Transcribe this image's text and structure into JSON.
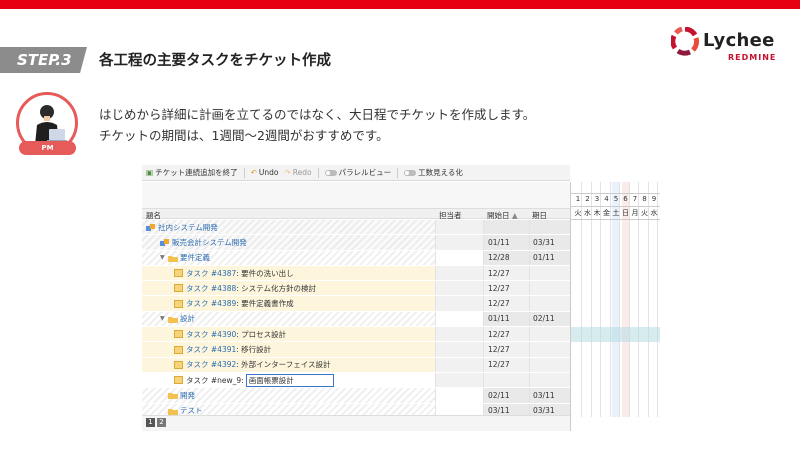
{
  "slide": {
    "step_label": "STEP.3",
    "step_title": "各工程の主要タスクをチケット作成",
    "description_line1": "はじめから詳細に計画を立てるのではなく、大日程でチケットを作成します。",
    "description_line2": "チケットの期間は、1週間〜2週間がおすすめです。",
    "avatar_badge": "PM",
    "logo_name": "Lychee",
    "logo_sub": "REDMINE",
    "accent_color": "#e60012"
  },
  "toolbar": {
    "end_continuous_add": "チケット連続追加を終了",
    "undo": "Undo",
    "redo": "Redo",
    "parallel_view": "パラレルビュー",
    "effort_visible": "工数見える化"
  },
  "columns": {
    "title": "題名",
    "assignee": "担当者",
    "start": "開始日",
    "due": "期日"
  },
  "rows": [
    {
      "kind": "project",
      "indent": 0,
      "label": "社内システム開発",
      "start": "",
      "due": ""
    },
    {
      "kind": "project",
      "indent": 1,
      "label": "販売会計システム開発",
      "start": "01/11",
      "due": "03/31"
    },
    {
      "kind": "version",
      "indent": 1,
      "label": "要件定義",
      "start": "12/28",
      "due": "01/11"
    },
    {
      "kind": "task",
      "indent": 2,
      "prefix": "タスク #4387",
      "label": ": 要件の洗い出し",
      "start": "12/27",
      "due": ""
    },
    {
      "kind": "task",
      "indent": 2,
      "prefix": "タスク #4388",
      "label": ": システム化方針の検討",
      "start": "12/27",
      "due": ""
    },
    {
      "kind": "task",
      "indent": 2,
      "prefix": "タスク #4389",
      "label": ": 要件定義書作成",
      "start": "12/27",
      "due": ""
    },
    {
      "kind": "version",
      "indent": 1,
      "label": "設計",
      "start": "01/11",
      "due": "02/11"
    },
    {
      "kind": "task",
      "indent": 2,
      "prefix": "タスク #4390",
      "label": ": プロセス設計",
      "start": "12/27",
      "due": ""
    },
    {
      "kind": "task",
      "indent": 2,
      "prefix": "タスク #4391",
      "label": ": 移行設計",
      "start": "12/27",
      "due": ""
    },
    {
      "kind": "task",
      "indent": 2,
      "prefix": "タスク #4392",
      "label": ": 外部インターフェイス設計",
      "start": "12/27",
      "due": ""
    },
    {
      "kind": "new",
      "indent": 2,
      "prefix": "タスク #new_9:",
      "input_value": "画面帳票設計",
      "start": "",
      "due": ""
    },
    {
      "kind": "version",
      "indent": 1,
      "label": "開発",
      "start": "02/11",
      "due": "03/11"
    },
    {
      "kind": "version",
      "indent": 1,
      "label": "テスト",
      "start": "03/11",
      "due": "03/31"
    }
  ],
  "calendar": {
    "days": [
      "1",
      "2",
      "3",
      "4",
      "5",
      "6",
      "7",
      "8",
      "9"
    ],
    "weekdays": [
      "火",
      "水",
      "木",
      "金",
      "土",
      "日",
      "月",
      "火",
      "水"
    ]
  },
  "pager": [
    "1",
    "2"
  ]
}
